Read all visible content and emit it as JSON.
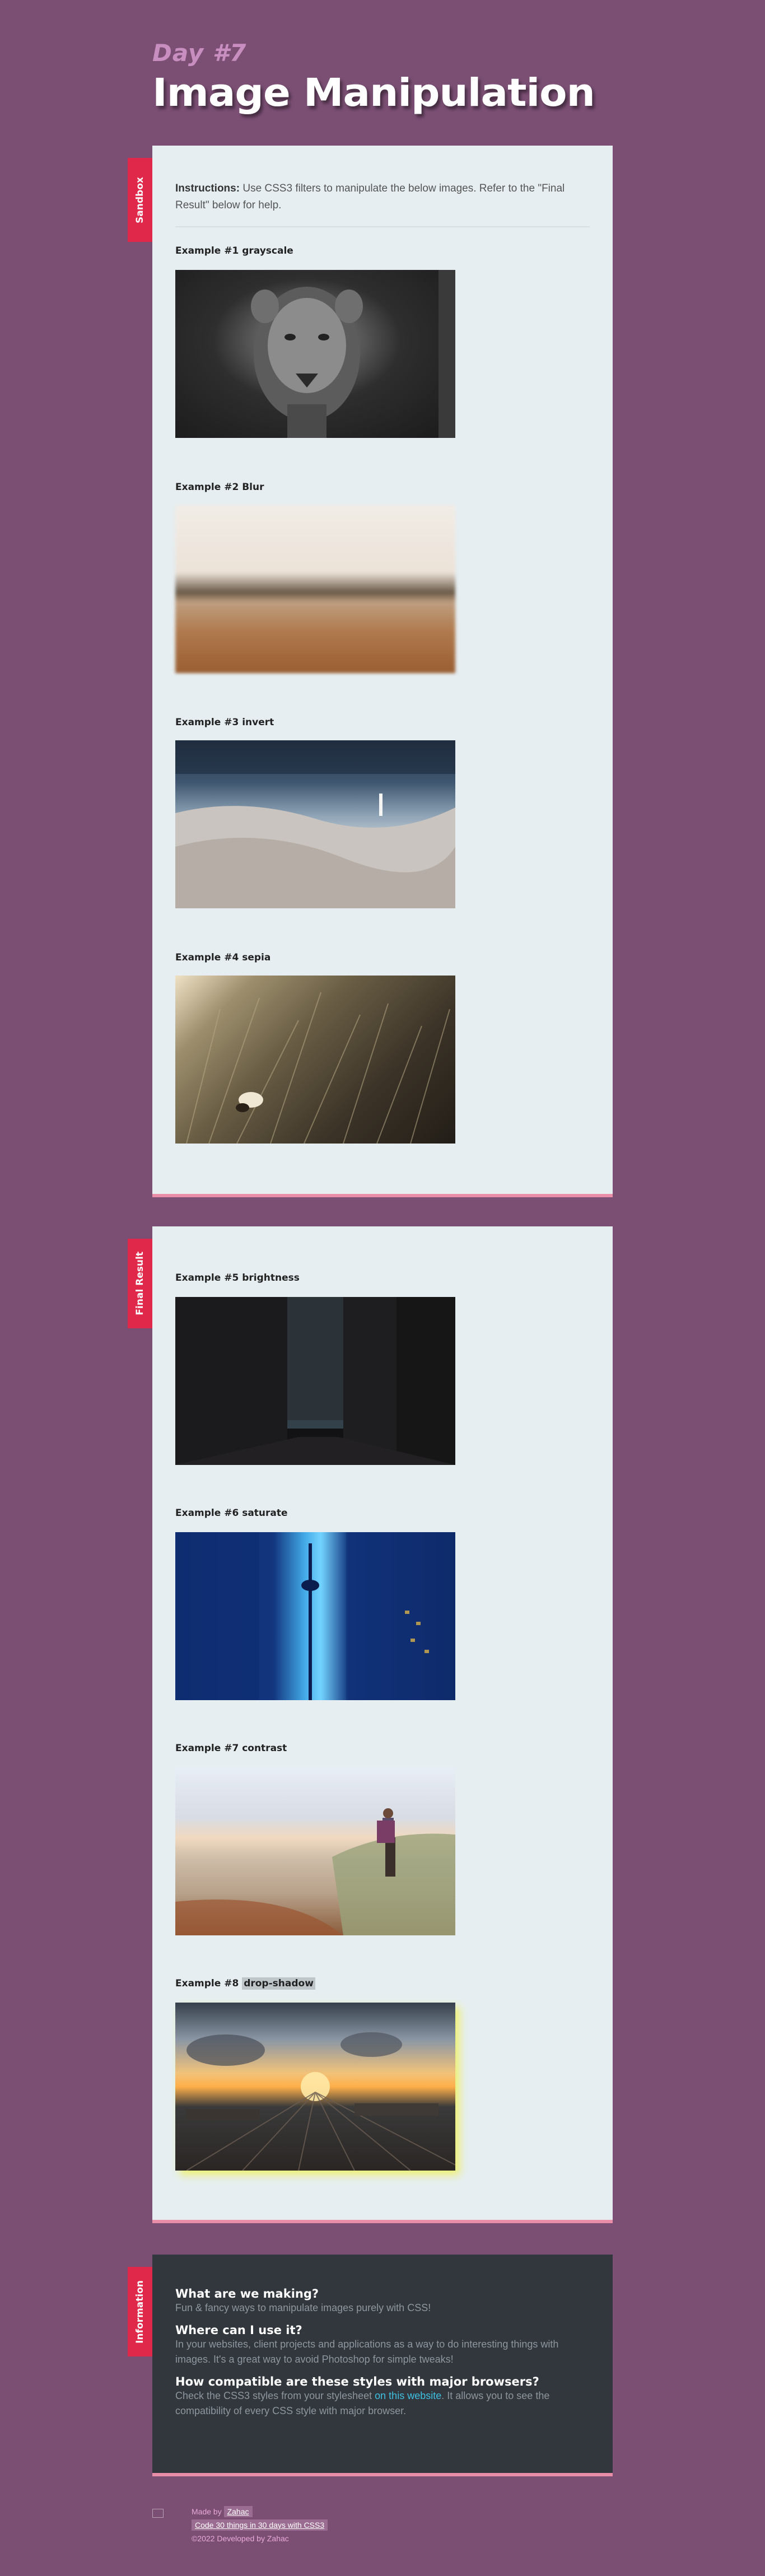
{
  "header": {
    "day": "Day #7",
    "title": "Image Manipulation"
  },
  "sandbox": {
    "tab_label": "Sandbox",
    "instructions_bold": "Instructions:",
    "instructions_text": " Use CSS3 filters to manipulate the below images. Refer to the \"Final Result\" below for help.",
    "examples": [
      {
        "label": "Example #1 grayscale"
      },
      {
        "label": "Example #2 Blur"
      },
      {
        "label": "Example #3 invert"
      },
      {
        "label": "Example #4 sepia"
      }
    ]
  },
  "final": {
    "tab_label": "Final Result",
    "examples": [
      {
        "label": "Example #5 brightness"
      },
      {
        "label": "Example #6 saturate"
      },
      {
        "label": "Example #7 contrast"
      },
      {
        "label_prefix": "Example #8 ",
        "label_code": "drop-shadow"
      }
    ]
  },
  "information": {
    "tab_label": "Information",
    "q1": "What are we making?",
    "a1": "Fun & fancy ways to manipulate images purely with CSS!",
    "q2": "Where can I use it?",
    "a2": "In your websites, client projects and applications as a way to do interesting things with images. It's a great way to avoid Photoshop for simple tweaks!",
    "q3": "How compatible are these styles with major browsers?",
    "a3_prefix": "Check the CSS3 styles from your stylesheet ",
    "a3_link": "on this website",
    "a3_suffix": ". It allows you to see the compatibility of every CSS style with major browser."
  },
  "footer": {
    "made_by": "Made by ",
    "author": "Zahac",
    "project": "Code 30 things in 30 days with CSS3",
    "copyright": "©2022 Developed by Zahac"
  },
  "colors": {
    "background": "#7b4f74",
    "card": "#e6eef1",
    "tab": "#e0294a",
    "info_bg": "#31373c",
    "link": "#3fc1e3"
  }
}
